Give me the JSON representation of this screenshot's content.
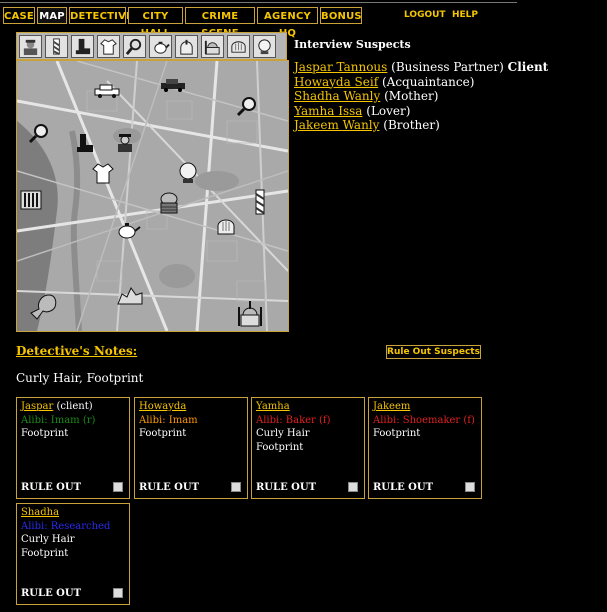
{
  "nav": {
    "tabs": [
      {
        "label": "CASE",
        "active": false
      },
      {
        "label": "MAP",
        "active": true
      },
      {
        "label": "DETECTIVE",
        "active": false
      },
      {
        "label": "CITY HALL",
        "active": false
      },
      {
        "label": "CRIME SCENE",
        "active": false
      },
      {
        "label": "AGENCY HQ",
        "active": false
      },
      {
        "label": "BONUS",
        "active": false
      }
    ],
    "logout": "LOGOUT",
    "help": "HELP"
  },
  "iconbar": {
    "icons": [
      "detective-icon",
      "barber-pole-icon",
      "boot-icon",
      "shirt-icon",
      "magnifier-icon",
      "teapot-icon",
      "mosque-icon",
      "mosque-dome-icon",
      "bread-icon",
      "crystal-ball-icon"
    ]
  },
  "map": {
    "markers": [
      "car-icon",
      "taxi-icon",
      "magnifier-icon",
      "boot-icon",
      "detective-icon",
      "shirt-icon",
      "crystal-ball-icon",
      "library-icon",
      "barber-pole-icon",
      "bread-basket-icon",
      "teapot-icon",
      "bread-icon",
      "rubble-icon",
      "pointing-hand-icon",
      "mosque-icon"
    ]
  },
  "interview": {
    "heading": "Interview Suspects",
    "suspects": [
      {
        "name": "Jaspar Tannous",
        "role": "(Business Partner)",
        "badge": "Client"
      },
      {
        "name": "Howayda Seif",
        "role": "(Acquaintance)",
        "badge": ""
      },
      {
        "name": "Shadha Wanly",
        "role": "(Mother)",
        "badge": ""
      },
      {
        "name": "Yamha Issa",
        "role": "(Lover)",
        "badge": ""
      },
      {
        "name": "Jakeem Wanly",
        "role": "(Brother)",
        "badge": ""
      }
    ]
  },
  "notes": {
    "title": "Detective's Notes:",
    "rule_out_button": "Rule Out Suspects",
    "clues": "Curly Hair, Footprint"
  },
  "cards": [
    {
      "name": "Jaspar",
      "tag": "(client)",
      "alibi": "Alibi: Imam (r)",
      "alibi_color": "#1a8c1a",
      "traits": [
        "Footprint"
      ],
      "rule_out": "RULE OUT"
    },
    {
      "name": "Howayda",
      "tag": "",
      "alibi": "Alibi: Imam",
      "alibi_color": "#ff9900",
      "traits": [
        "Footprint"
      ],
      "rule_out": "RULE OUT"
    },
    {
      "name": "Yamha",
      "tag": "",
      "alibi": "Alibi: Baker (f)",
      "alibi_color": "#e02020",
      "traits": [
        "Curly Hair",
        "Footprint"
      ],
      "rule_out": "RULE OUT"
    },
    {
      "name": "Jakeem",
      "tag": "",
      "alibi": "Alibi: Shoemaker (f)",
      "alibi_color": "#e02020",
      "traits": [
        "Footprint"
      ],
      "rule_out": "RULE OUT"
    },
    {
      "name": "Shadha",
      "tag": "",
      "alibi": "Alibi: Researched",
      "alibi_color": "#2a2af0",
      "traits": [
        "Curly Hair",
        "Footprint"
      ],
      "rule_out": "RULE OUT"
    }
  ]
}
